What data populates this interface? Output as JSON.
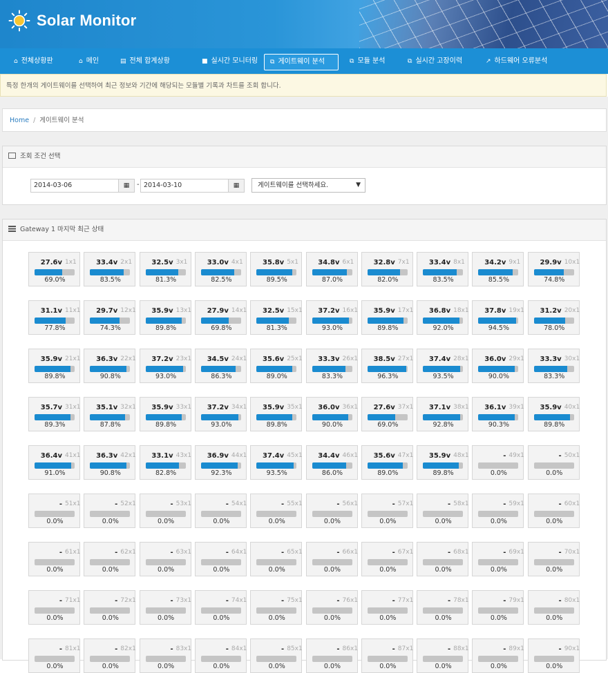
{
  "app": {
    "brand": "Solar Monitor"
  },
  "nav": [
    {
      "label": "전체상황판",
      "icon": "home-icon"
    },
    {
      "label": "메인",
      "icon": "home-icon"
    },
    {
      "label": "전체 합계상황",
      "icon": "document-icon"
    },
    {
      "label": "실시간 모니터링",
      "icon": "video-icon"
    },
    {
      "label": "게이트웨이 분석",
      "icon": "copy-icon",
      "active": true
    },
    {
      "label": "모듈 분석",
      "icon": "copy-icon"
    },
    {
      "label": "실시간 고장이력",
      "icon": "copy-icon"
    },
    {
      "label": "하드웨어 오류분석",
      "icon": "external-link-icon"
    }
  ],
  "notice": "특정 한개의 게이트웨이를 선택하여 최근 정보와 기간에 해당되는 모듈별 기록과 차트를 조회 합니다.",
  "breadcrumb": {
    "home": "Home",
    "separator": "/",
    "current": "게이트웨이 분석"
  },
  "query": {
    "title": "조회 조건 선택",
    "start_date": "2014-03-06",
    "separator": "-",
    "end_date": "2014-03-10",
    "gateway_select": "게이트웨이를 선택하세요."
  },
  "status": {
    "title": "Gateway 1 마지막 최근 상태",
    "modules": [
      {
        "id": "1x1",
        "volt": "27.6v",
        "pct": "69.0%",
        "fill": 69.0
      },
      {
        "id": "2x1",
        "volt": "33.4v",
        "pct": "83.5%",
        "fill": 83.5
      },
      {
        "id": "3x1",
        "volt": "32.5v",
        "pct": "81.3%",
        "fill": 81.3
      },
      {
        "id": "4x1",
        "volt": "33.0v",
        "pct": "82.5%",
        "fill": 82.5
      },
      {
        "id": "5x1",
        "volt": "35.8v",
        "pct": "89.5%",
        "fill": 89.5
      },
      {
        "id": "6x1",
        "volt": "34.8v",
        "pct": "87.0%",
        "fill": 87.0
      },
      {
        "id": "7x1",
        "volt": "32.8v",
        "pct": "82.0%",
        "fill": 82.0
      },
      {
        "id": "8x1",
        "volt": "33.4v",
        "pct": "83.5%",
        "fill": 83.5
      },
      {
        "id": "9x1",
        "volt": "34.2v",
        "pct": "85.5%",
        "fill": 85.5
      },
      {
        "id": "10x1",
        "volt": "29.9v",
        "pct": "74.8%",
        "fill": 74.8
      },
      {
        "id": "11x1",
        "volt": "31.1v",
        "pct": "77.8%",
        "fill": 77.8
      },
      {
        "id": "12x1",
        "volt": "29.7v",
        "pct": "74.3%",
        "fill": 74.3
      },
      {
        "id": "13x1",
        "volt": "35.9v",
        "pct": "89.8%",
        "fill": 89.8
      },
      {
        "id": "14x1",
        "volt": "27.9v",
        "pct": "69.8%",
        "fill": 69.8
      },
      {
        "id": "15x1",
        "volt": "32.5v",
        "pct": "81.3%",
        "fill": 81.3
      },
      {
        "id": "16x1",
        "volt": "37.2v",
        "pct": "93.0%",
        "fill": 93.0
      },
      {
        "id": "17x1",
        "volt": "35.9v",
        "pct": "89.8%",
        "fill": 89.8
      },
      {
        "id": "18x1",
        "volt": "36.8v",
        "pct": "92.0%",
        "fill": 92.0
      },
      {
        "id": "19x1",
        "volt": "37.8v",
        "pct": "94.5%",
        "fill": 94.5
      },
      {
        "id": "20x1",
        "volt": "31.2v",
        "pct": "78.0%",
        "fill": 78.0
      },
      {
        "id": "21x1",
        "volt": "35.9v",
        "pct": "89.8%",
        "fill": 89.8
      },
      {
        "id": "22x1",
        "volt": "36.3v",
        "pct": "90.8%",
        "fill": 90.8
      },
      {
        "id": "23x1",
        "volt": "37.2v",
        "pct": "93.0%",
        "fill": 93.0
      },
      {
        "id": "24x1",
        "volt": "34.5v",
        "pct": "86.3%",
        "fill": 86.3
      },
      {
        "id": "25x1",
        "volt": "35.6v",
        "pct": "89.0%",
        "fill": 89.0
      },
      {
        "id": "26x1",
        "volt": "33.3v",
        "pct": "83.3%",
        "fill": 83.3
      },
      {
        "id": "27x1",
        "volt": "38.5v",
        "pct": "96.3%",
        "fill": 96.3
      },
      {
        "id": "28x1",
        "volt": "37.4v",
        "pct": "93.5%",
        "fill": 93.5
      },
      {
        "id": "29x1",
        "volt": "36.0v",
        "pct": "90.0%",
        "fill": 90.0
      },
      {
        "id": "30x1",
        "volt": "33.3v",
        "pct": "83.3%",
        "fill": 83.3
      },
      {
        "id": "31x1",
        "volt": "35.7v",
        "pct": "89.3%",
        "fill": 89.3
      },
      {
        "id": "32x1",
        "volt": "35.1v",
        "pct": "87.8%",
        "fill": 87.8
      },
      {
        "id": "33x1",
        "volt": "35.9v",
        "pct": "89.8%",
        "fill": 89.8
      },
      {
        "id": "34x1",
        "volt": "37.2v",
        "pct": "93.0%",
        "fill": 93.0
      },
      {
        "id": "35x1",
        "volt": "35.9v",
        "pct": "89.8%",
        "fill": 89.8
      },
      {
        "id": "36x1",
        "volt": "36.0v",
        "pct": "90.0%",
        "fill": 90.0
      },
      {
        "id": "37x1",
        "volt": "27.6v",
        "pct": "69.0%",
        "fill": 69.0
      },
      {
        "id": "38x1",
        "volt": "37.1v",
        "pct": "92.8%",
        "fill": 92.8
      },
      {
        "id": "39x1",
        "volt": "36.1v",
        "pct": "90.3%",
        "fill": 90.3
      },
      {
        "id": "40x1",
        "volt": "35.9v",
        "pct": "89.8%",
        "fill": 89.8
      },
      {
        "id": "41x1",
        "volt": "36.4v",
        "pct": "91.0%",
        "fill": 91.0
      },
      {
        "id": "42x1",
        "volt": "36.3v",
        "pct": "90.8%",
        "fill": 90.8
      },
      {
        "id": "43x1",
        "volt": "33.1v",
        "pct": "82.8%",
        "fill": 82.8
      },
      {
        "id": "44x1",
        "volt": "36.9v",
        "pct": "92.3%",
        "fill": 92.3
      },
      {
        "id": "45x1",
        "volt": "37.4v",
        "pct": "93.5%",
        "fill": 93.5
      },
      {
        "id": "46x1",
        "volt": "34.4v",
        "pct": "86.0%",
        "fill": 86.0
      },
      {
        "id": "47x1",
        "volt": "35.6v",
        "pct": "89.0%",
        "fill": 89.0
      },
      {
        "id": "48x1",
        "volt": "35.9v",
        "pct": "89.8%",
        "fill": 89.8
      },
      {
        "id": "49x1",
        "volt": "-",
        "pct": "0.0%",
        "fill": 0
      },
      {
        "id": "50x1",
        "volt": "-",
        "pct": "0.0%",
        "fill": 0
      },
      {
        "id": "51x1",
        "volt": "-",
        "pct": "0.0%",
        "fill": 0
      },
      {
        "id": "52x1",
        "volt": "-",
        "pct": "0.0%",
        "fill": 0
      },
      {
        "id": "53x1",
        "volt": "-",
        "pct": "0.0%",
        "fill": 0
      },
      {
        "id": "54x1",
        "volt": "-",
        "pct": "0.0%",
        "fill": 0
      },
      {
        "id": "55x1",
        "volt": "-",
        "pct": "0.0%",
        "fill": 0
      },
      {
        "id": "56x1",
        "volt": "-",
        "pct": "0.0%",
        "fill": 0
      },
      {
        "id": "57x1",
        "volt": "-",
        "pct": "0.0%",
        "fill": 0
      },
      {
        "id": "58x1",
        "volt": "-",
        "pct": "0.0%",
        "fill": 0
      },
      {
        "id": "59x1",
        "volt": "-",
        "pct": "0.0%",
        "fill": 0
      },
      {
        "id": "60x1",
        "volt": "-",
        "pct": "0.0%",
        "fill": 0
      },
      {
        "id": "61x1",
        "volt": "-",
        "pct": "0.0%",
        "fill": 0
      },
      {
        "id": "62x1",
        "volt": "-",
        "pct": "0.0%",
        "fill": 0
      },
      {
        "id": "63x1",
        "volt": "-",
        "pct": "0.0%",
        "fill": 0
      },
      {
        "id": "64x1",
        "volt": "-",
        "pct": "0.0%",
        "fill": 0
      },
      {
        "id": "65x1",
        "volt": "-",
        "pct": "0.0%",
        "fill": 0
      },
      {
        "id": "66x1",
        "volt": "-",
        "pct": "0.0%",
        "fill": 0
      },
      {
        "id": "67x1",
        "volt": "-",
        "pct": "0.0%",
        "fill": 0
      },
      {
        "id": "68x1",
        "volt": "-",
        "pct": "0.0%",
        "fill": 0
      },
      {
        "id": "69x1",
        "volt": "-",
        "pct": "0.0%",
        "fill": 0
      },
      {
        "id": "70x1",
        "volt": "-",
        "pct": "0.0%",
        "fill": 0
      },
      {
        "id": "71x1",
        "volt": "-",
        "pct": "0.0%",
        "fill": 0
      },
      {
        "id": "72x1",
        "volt": "-",
        "pct": "0.0%",
        "fill": 0
      },
      {
        "id": "73x1",
        "volt": "-",
        "pct": "0.0%",
        "fill": 0
      },
      {
        "id": "74x1",
        "volt": "-",
        "pct": "0.0%",
        "fill": 0
      },
      {
        "id": "75x1",
        "volt": "-",
        "pct": "0.0%",
        "fill": 0
      },
      {
        "id": "76x1",
        "volt": "-",
        "pct": "0.0%",
        "fill": 0
      },
      {
        "id": "77x1",
        "volt": "-",
        "pct": "0.0%",
        "fill": 0
      },
      {
        "id": "78x1",
        "volt": "-",
        "pct": "0.0%",
        "fill": 0
      },
      {
        "id": "79x1",
        "volt": "-",
        "pct": "0.0%",
        "fill": 0
      },
      {
        "id": "80x1",
        "volt": "-",
        "pct": "0.0%",
        "fill": 0
      },
      {
        "id": "81x1",
        "volt": "-",
        "pct": "0.0%",
        "fill": 0
      },
      {
        "id": "82x1",
        "volt": "-",
        "pct": "0.0%",
        "fill": 0
      },
      {
        "id": "83x1",
        "volt": "-",
        "pct": "0.0%",
        "fill": 0
      },
      {
        "id": "84x1",
        "volt": "-",
        "pct": "0.0%",
        "fill": 0
      },
      {
        "id": "85x1",
        "volt": "-",
        "pct": "0.0%",
        "fill": 0
      },
      {
        "id": "86x1",
        "volt": "-",
        "pct": "0.0%",
        "fill": 0
      },
      {
        "id": "87x1",
        "volt": "-",
        "pct": "0.0%",
        "fill": 0
      },
      {
        "id": "88x1",
        "volt": "-",
        "pct": "0.0%",
        "fill": 0
      },
      {
        "id": "89x1",
        "volt": "-",
        "pct": "0.0%",
        "fill": 0
      },
      {
        "id": "90x1",
        "volt": "-",
        "pct": "0.0%",
        "fill": 0
      }
    ]
  },
  "colors": {
    "nav": "#1c8fd6",
    "bar_fill": "#1a8bd0",
    "bar_empty": "#c5c5c5",
    "notice_bg": "#fcf8e3"
  }
}
